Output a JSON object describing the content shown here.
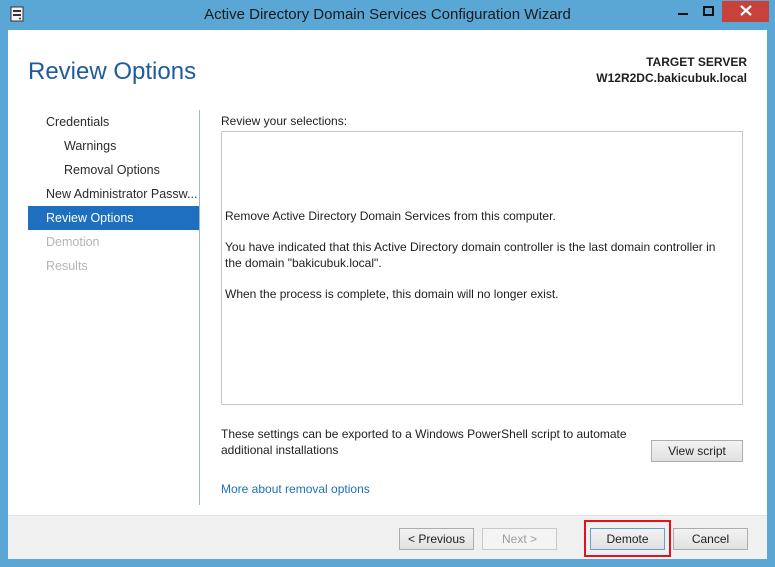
{
  "window": {
    "title": "Active Directory Domain Services Configuration Wizard"
  },
  "header": {
    "page_title": "Review Options",
    "target_label": "TARGET SERVER",
    "target_value": "W12R2DC.bakicubuk.local"
  },
  "sidebar": {
    "items": [
      {
        "label": "Credentials",
        "state": "normal"
      },
      {
        "label": "Warnings",
        "state": "normal"
      },
      {
        "label": "Removal Options",
        "state": "normal"
      },
      {
        "label": "New Administrator Passw...",
        "state": "normal"
      },
      {
        "label": "Review Options",
        "state": "active"
      },
      {
        "label": "Demotion",
        "state": "disabled"
      },
      {
        "label": "Results",
        "state": "disabled"
      }
    ]
  },
  "main": {
    "review_label": "Review your selections:",
    "review_lines": [
      "Remove Active Directory Domain Services from this computer.",
      "You have indicated that this Active Directory domain controller is the last domain controller in the domain \"bakicubuk.local\".",
      "When the process is complete, this domain will no longer exist."
    ],
    "export_text": "These settings can be exported to a Windows PowerShell script to automate additional installations",
    "view_script_label": "View script",
    "more_link": "More about removal options"
  },
  "footer": {
    "previous_label": "< Previous",
    "next_label": "Next >",
    "demote_label": "Demote",
    "cancel_label": "Cancel"
  },
  "colors": {
    "title_bar": "#5aa7d6",
    "accent": "#1e6fbf",
    "page_title": "#1e5b9f",
    "close_button": "#c8413b",
    "highlight": "#e2111b"
  }
}
